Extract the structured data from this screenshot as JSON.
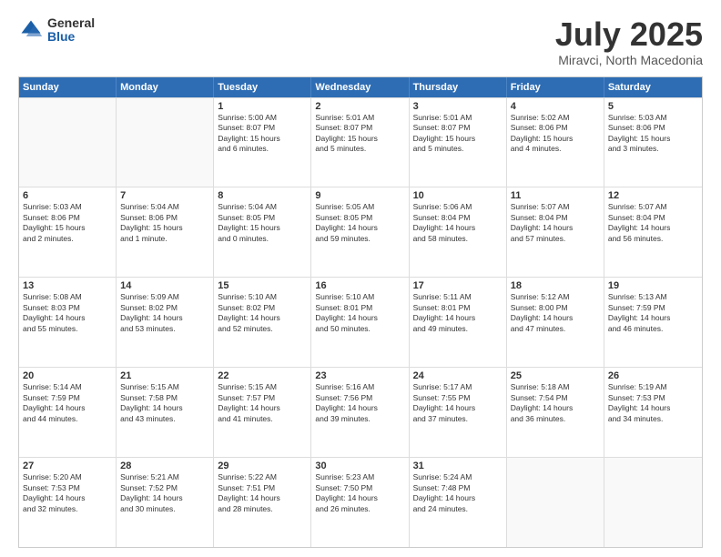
{
  "header": {
    "logo_general": "General",
    "logo_blue": "Blue",
    "month_title": "July 2025",
    "location": "Miravci, North Macedonia"
  },
  "days_of_week": [
    "Sunday",
    "Monday",
    "Tuesday",
    "Wednesday",
    "Thursday",
    "Friday",
    "Saturday"
  ],
  "rows": [
    [
      {
        "day": "",
        "empty": true
      },
      {
        "day": "",
        "empty": true
      },
      {
        "day": "1",
        "lines": [
          "Sunrise: 5:00 AM",
          "Sunset: 8:07 PM",
          "Daylight: 15 hours",
          "and 6 minutes."
        ]
      },
      {
        "day": "2",
        "lines": [
          "Sunrise: 5:01 AM",
          "Sunset: 8:07 PM",
          "Daylight: 15 hours",
          "and 5 minutes."
        ]
      },
      {
        "day": "3",
        "lines": [
          "Sunrise: 5:01 AM",
          "Sunset: 8:07 PM",
          "Daylight: 15 hours",
          "and 5 minutes."
        ]
      },
      {
        "day": "4",
        "lines": [
          "Sunrise: 5:02 AM",
          "Sunset: 8:06 PM",
          "Daylight: 15 hours",
          "and 4 minutes."
        ]
      },
      {
        "day": "5",
        "lines": [
          "Sunrise: 5:03 AM",
          "Sunset: 8:06 PM",
          "Daylight: 15 hours",
          "and 3 minutes."
        ]
      }
    ],
    [
      {
        "day": "6",
        "lines": [
          "Sunrise: 5:03 AM",
          "Sunset: 8:06 PM",
          "Daylight: 15 hours",
          "and 2 minutes."
        ]
      },
      {
        "day": "7",
        "lines": [
          "Sunrise: 5:04 AM",
          "Sunset: 8:06 PM",
          "Daylight: 15 hours",
          "and 1 minute."
        ]
      },
      {
        "day": "8",
        "lines": [
          "Sunrise: 5:04 AM",
          "Sunset: 8:05 PM",
          "Daylight: 15 hours",
          "and 0 minutes."
        ]
      },
      {
        "day": "9",
        "lines": [
          "Sunrise: 5:05 AM",
          "Sunset: 8:05 PM",
          "Daylight: 14 hours",
          "and 59 minutes."
        ]
      },
      {
        "day": "10",
        "lines": [
          "Sunrise: 5:06 AM",
          "Sunset: 8:04 PM",
          "Daylight: 14 hours",
          "and 58 minutes."
        ]
      },
      {
        "day": "11",
        "lines": [
          "Sunrise: 5:07 AM",
          "Sunset: 8:04 PM",
          "Daylight: 14 hours",
          "and 57 minutes."
        ]
      },
      {
        "day": "12",
        "lines": [
          "Sunrise: 5:07 AM",
          "Sunset: 8:04 PM",
          "Daylight: 14 hours",
          "and 56 minutes."
        ]
      }
    ],
    [
      {
        "day": "13",
        "lines": [
          "Sunrise: 5:08 AM",
          "Sunset: 8:03 PM",
          "Daylight: 14 hours",
          "and 55 minutes."
        ]
      },
      {
        "day": "14",
        "lines": [
          "Sunrise: 5:09 AM",
          "Sunset: 8:02 PM",
          "Daylight: 14 hours",
          "and 53 minutes."
        ]
      },
      {
        "day": "15",
        "lines": [
          "Sunrise: 5:10 AM",
          "Sunset: 8:02 PM",
          "Daylight: 14 hours",
          "and 52 minutes."
        ]
      },
      {
        "day": "16",
        "lines": [
          "Sunrise: 5:10 AM",
          "Sunset: 8:01 PM",
          "Daylight: 14 hours",
          "and 50 minutes."
        ]
      },
      {
        "day": "17",
        "lines": [
          "Sunrise: 5:11 AM",
          "Sunset: 8:01 PM",
          "Daylight: 14 hours",
          "and 49 minutes."
        ]
      },
      {
        "day": "18",
        "lines": [
          "Sunrise: 5:12 AM",
          "Sunset: 8:00 PM",
          "Daylight: 14 hours",
          "and 47 minutes."
        ]
      },
      {
        "day": "19",
        "lines": [
          "Sunrise: 5:13 AM",
          "Sunset: 7:59 PM",
          "Daylight: 14 hours",
          "and 46 minutes."
        ]
      }
    ],
    [
      {
        "day": "20",
        "lines": [
          "Sunrise: 5:14 AM",
          "Sunset: 7:59 PM",
          "Daylight: 14 hours",
          "and 44 minutes."
        ]
      },
      {
        "day": "21",
        "lines": [
          "Sunrise: 5:15 AM",
          "Sunset: 7:58 PM",
          "Daylight: 14 hours",
          "and 43 minutes."
        ]
      },
      {
        "day": "22",
        "lines": [
          "Sunrise: 5:15 AM",
          "Sunset: 7:57 PM",
          "Daylight: 14 hours",
          "and 41 minutes."
        ]
      },
      {
        "day": "23",
        "lines": [
          "Sunrise: 5:16 AM",
          "Sunset: 7:56 PM",
          "Daylight: 14 hours",
          "and 39 minutes."
        ]
      },
      {
        "day": "24",
        "lines": [
          "Sunrise: 5:17 AM",
          "Sunset: 7:55 PM",
          "Daylight: 14 hours",
          "and 37 minutes."
        ]
      },
      {
        "day": "25",
        "lines": [
          "Sunrise: 5:18 AM",
          "Sunset: 7:54 PM",
          "Daylight: 14 hours",
          "and 36 minutes."
        ]
      },
      {
        "day": "26",
        "lines": [
          "Sunrise: 5:19 AM",
          "Sunset: 7:53 PM",
          "Daylight: 14 hours",
          "and 34 minutes."
        ]
      }
    ],
    [
      {
        "day": "27",
        "lines": [
          "Sunrise: 5:20 AM",
          "Sunset: 7:53 PM",
          "Daylight: 14 hours",
          "and 32 minutes."
        ]
      },
      {
        "day": "28",
        "lines": [
          "Sunrise: 5:21 AM",
          "Sunset: 7:52 PM",
          "Daylight: 14 hours",
          "and 30 minutes."
        ]
      },
      {
        "day": "29",
        "lines": [
          "Sunrise: 5:22 AM",
          "Sunset: 7:51 PM",
          "Daylight: 14 hours",
          "and 28 minutes."
        ]
      },
      {
        "day": "30",
        "lines": [
          "Sunrise: 5:23 AM",
          "Sunset: 7:50 PM",
          "Daylight: 14 hours",
          "and 26 minutes."
        ]
      },
      {
        "day": "31",
        "lines": [
          "Sunrise: 5:24 AM",
          "Sunset: 7:48 PM",
          "Daylight: 14 hours",
          "and 24 minutes."
        ]
      },
      {
        "day": "",
        "empty": true
      },
      {
        "day": "",
        "empty": true
      }
    ]
  ]
}
